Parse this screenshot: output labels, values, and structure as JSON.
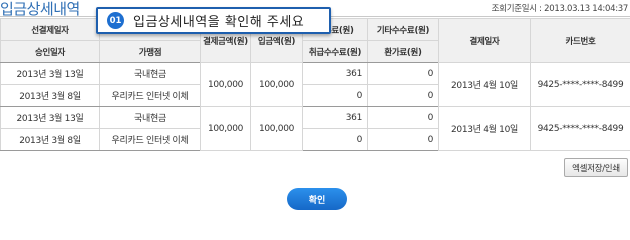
{
  "page": {
    "title": "입금상세내역",
    "query_time": "조회기준일시 : 2013.03.13 14:04:37"
  },
  "tooltip": {
    "number": "01",
    "text": "입금상세내역을 확인해 주세요"
  },
  "table": {
    "header_row1": [
      "선결제일자",
      "",
      "결제금액(원)",
      "입금액(원)",
      "수수료(원)",
      "기타수수료(원)",
      "결제일자",
      "카드번호"
    ],
    "header_row2": [
      "승인일자",
      "가맹점",
      "취급수수료(원)",
      "환가료(원)"
    ],
    "groups": [
      {
        "rows": [
          {
            "date": "2013년 3월 13일",
            "merchant": "국내현금",
            "fee": "361",
            "other_fee": "0"
          },
          {
            "date": "2013년 3월 8일",
            "merchant": "우리카드 인터넷 이체",
            "fee": "0",
            "other_fee": "0"
          }
        ],
        "amount": "100,000",
        "deposit": "100,000",
        "pay_date": "2013년 4월 10일",
        "card": "9425-****-****-8499"
      },
      {
        "rows": [
          {
            "date": "2013년 3월 13일",
            "merchant": "국내현금",
            "fee": "361",
            "other_fee": "0"
          },
          {
            "date": "2013년 3월 8일",
            "merchant": "우리카드 인터넷 이체",
            "fee": "0",
            "other_fee": "0"
          }
        ],
        "amount": "100,000",
        "deposit": "100,000",
        "pay_date": "2013년 4월 10일",
        "card": "9425-****-****-8499"
      }
    ]
  },
  "buttons": {
    "export": "엑셀저장/인쇄",
    "confirm": "확인"
  }
}
